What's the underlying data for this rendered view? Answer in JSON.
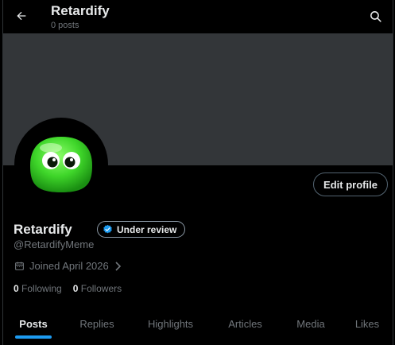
{
  "header": {
    "title": "Retardify",
    "subtitle": "0 posts"
  },
  "profile": {
    "name": "Retardify",
    "badge_label": "Under review",
    "handle": "@RetardifyMeme",
    "joined": "Joined April 2026",
    "following_count": "0",
    "following_label": "Following",
    "followers_count": "0",
    "followers_label": "Followers",
    "edit_label": "Edit profile"
  },
  "tabs": [
    {
      "label": "Posts",
      "active": true
    },
    {
      "label": "Replies",
      "active": false
    },
    {
      "label": "Highlights",
      "active": false
    },
    {
      "label": "Articles",
      "active": false
    },
    {
      "label": "Media",
      "active": false
    },
    {
      "label": "Likes",
      "active": false
    }
  ],
  "colors": {
    "background": "#000000",
    "banner": "#333639",
    "accent": "#1d9bf0",
    "text_primary": "#e7e9ea",
    "text_secondary": "#71767b",
    "avatar_green": "#3fd62a"
  },
  "icons": {
    "back": "arrow-left-icon",
    "search": "search-icon",
    "verified": "verified-badge-icon",
    "calendar": "calendar-icon",
    "chevron": "chevron-right-icon"
  }
}
